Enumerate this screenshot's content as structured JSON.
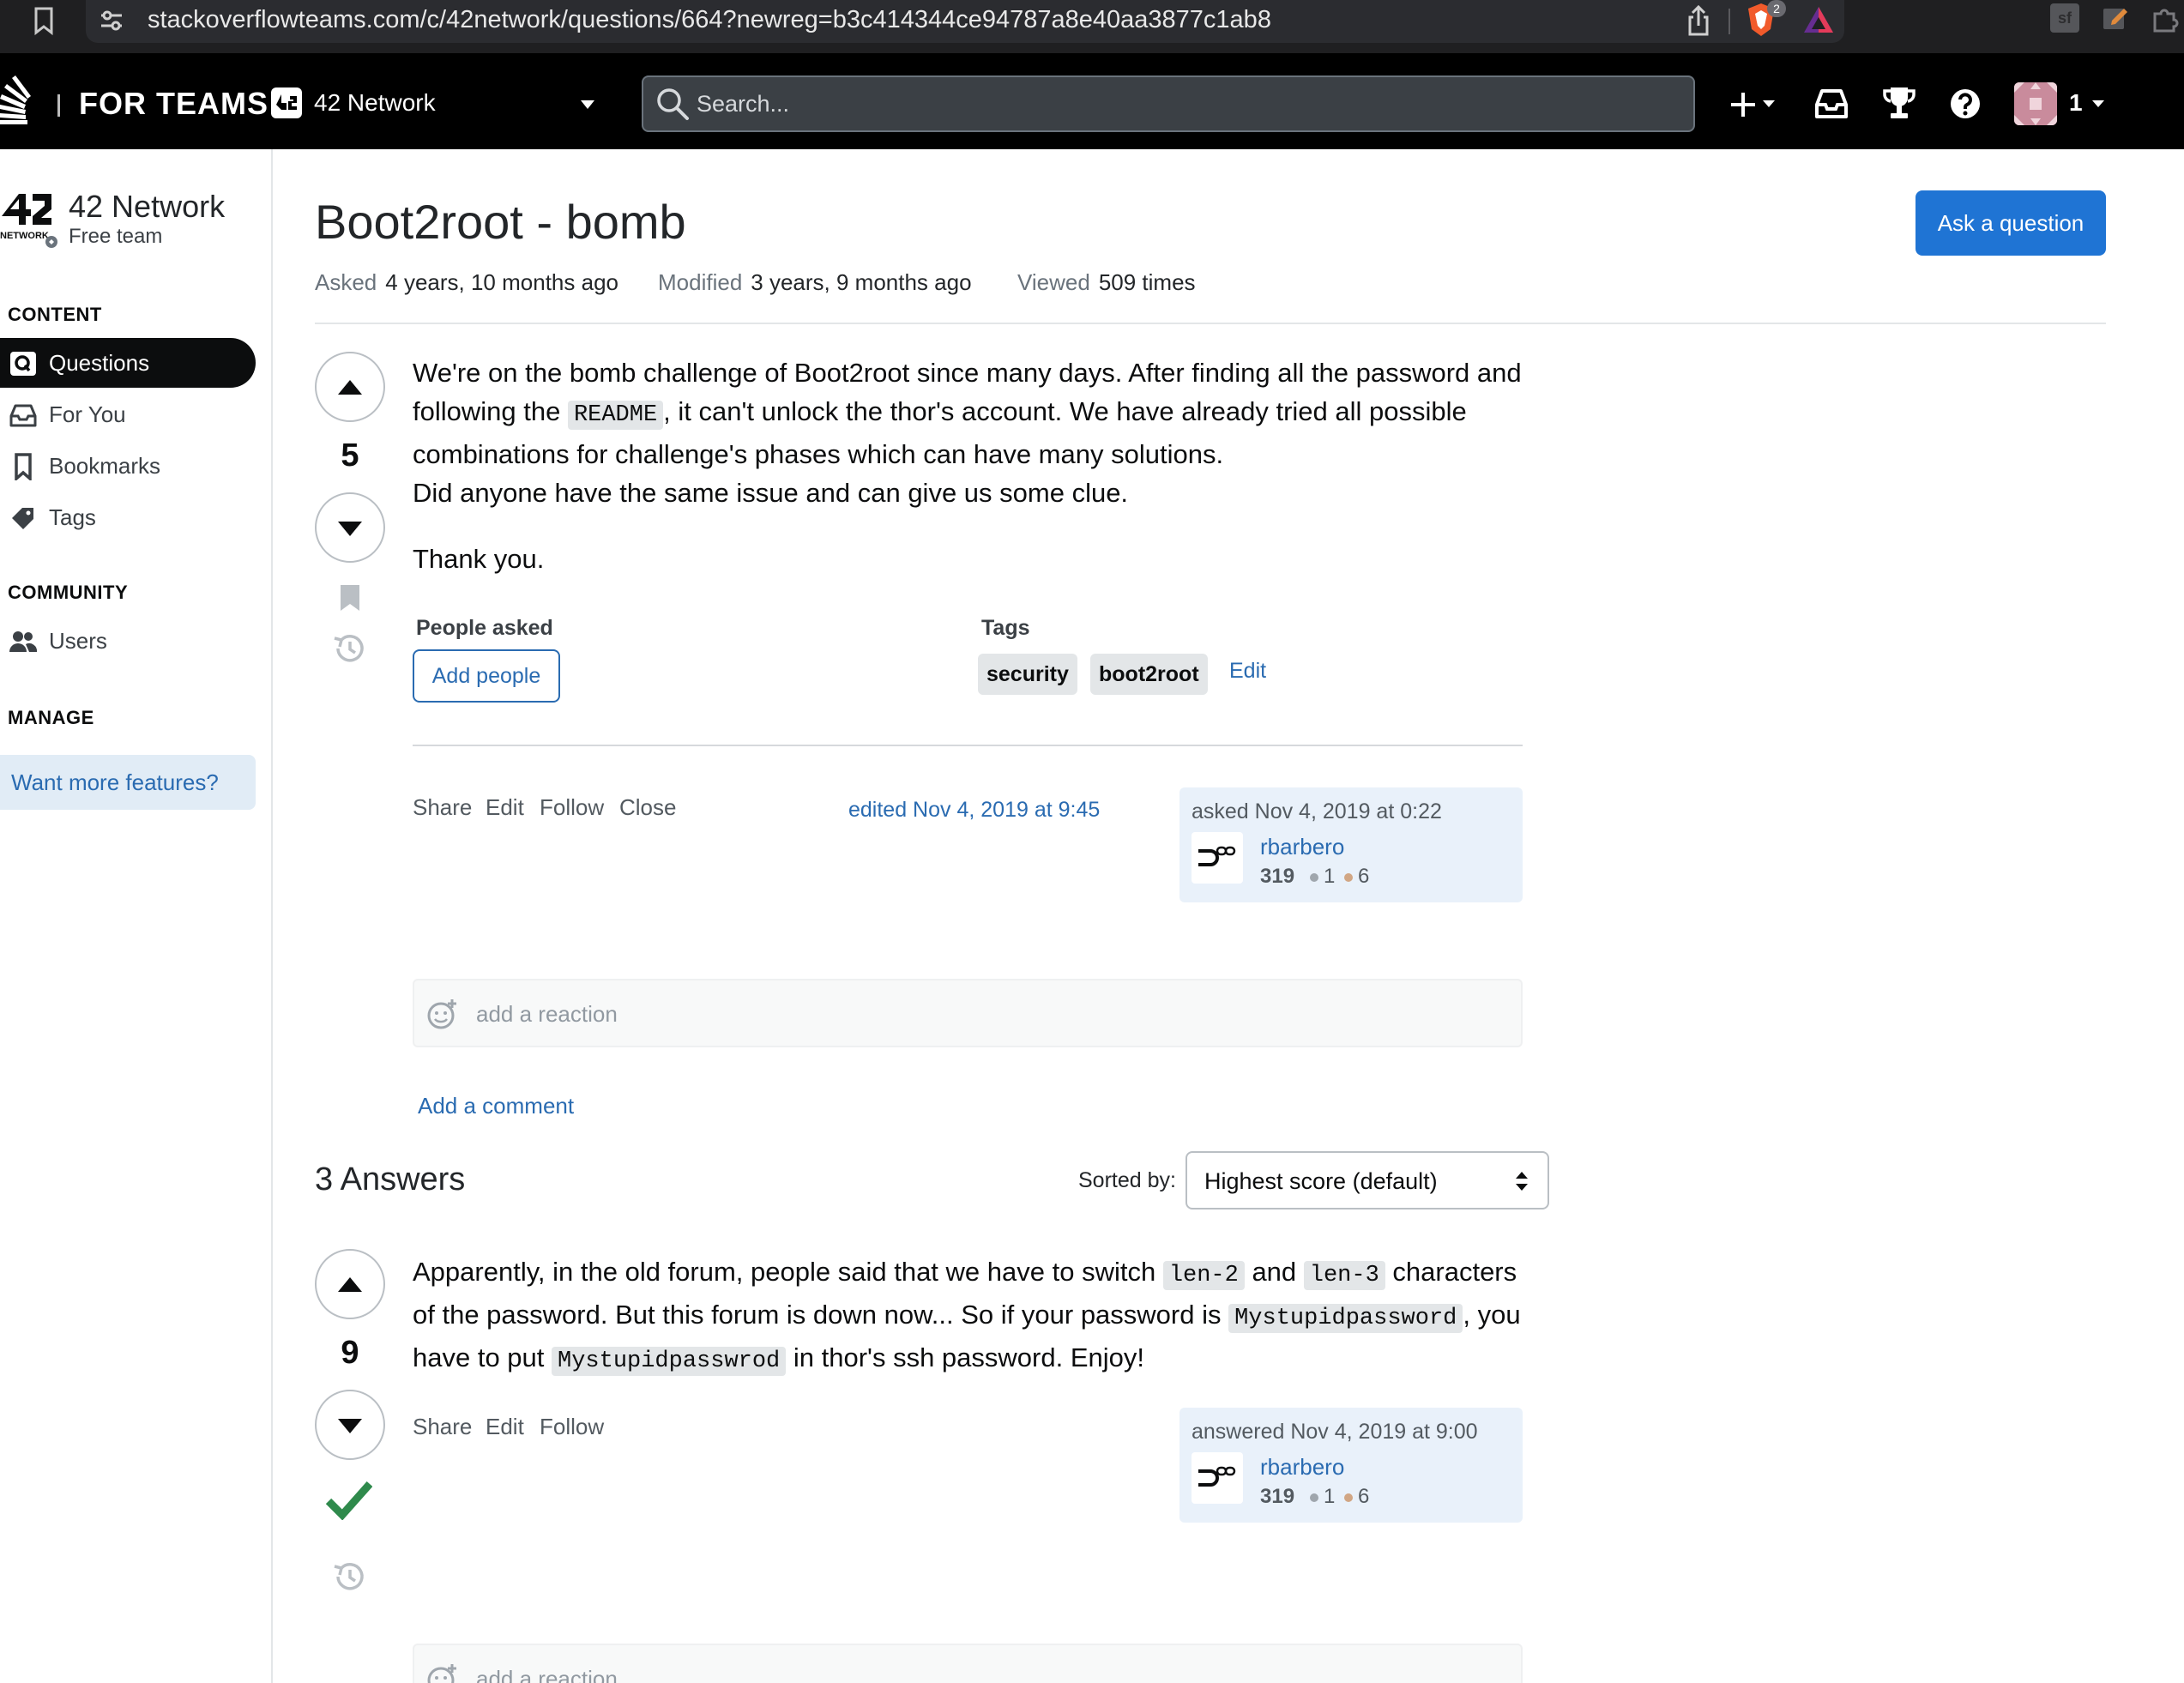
{
  "browser": {
    "url": "stackoverflowteams.com/c/42network/questions/664?newreg=b3c414344ce94787a8e40aa3877c1ab8",
    "shield_badge": "2"
  },
  "topnav": {
    "for_teams": "FOR TEAMS",
    "team_name": "42 Network",
    "search_placeholder": "Search...",
    "notification_count": "1"
  },
  "sidebar": {
    "team_name": "42 Network",
    "team_plan": "Free team",
    "sections": {
      "content": "CONTENT",
      "community": "COMMUNITY",
      "manage": "MANAGE"
    },
    "items": [
      {
        "label": "Questions",
        "icon": "questions-icon",
        "active": true
      },
      {
        "label": "For You",
        "icon": "inbox-icon",
        "active": false
      },
      {
        "label": "Bookmarks",
        "icon": "bookmark-icon",
        "active": false
      },
      {
        "label": "Tags",
        "icon": "tag-icon",
        "active": false
      },
      {
        "label": "Users",
        "icon": "users-icon",
        "active": false
      }
    ],
    "cta": "Want more features?"
  },
  "question": {
    "title": "Boot2root - bomb",
    "ask_button": "Ask a question",
    "asked_label": "Asked",
    "asked_value": "4 years, 10 months ago",
    "modified_label": "Modified",
    "modified_value": "3 years, 9 months ago",
    "viewed_label": "Viewed",
    "viewed_value": "509 times",
    "score": "5",
    "body": {
      "p1_a": "We're on the bomb challenge of Boot2root since many days. After finding all the password and following the ",
      "p1_code": "README",
      "p1_b": ", it can't unlock the thor's account. We have already tried all possible combinations for challenge's phases which can have many solutions.",
      "p1_c": "Did anyone have the same issue and can give us some clue.",
      "p2": "Thank you."
    },
    "people_asked_label": "People asked",
    "add_people": "Add people",
    "tags_label": "Tags",
    "tags": [
      "security",
      "boot2root"
    ],
    "tags_edit": "Edit",
    "menu": [
      "Share",
      "Edit",
      "Follow",
      "Close"
    ],
    "edited": "edited Nov 4, 2019 at 9:45",
    "user_card": {
      "action": "asked Nov 4, 2019 at 0:22",
      "name": "rbarbero",
      "rep": "319",
      "silver": "1",
      "bronze": "6"
    },
    "reaction": "add a reaction",
    "add_comment": "Add a comment"
  },
  "answers": {
    "count_label": "3 Answers",
    "sorted_label": "Sorted by:",
    "sort_value": "Highest score (default)",
    "items": [
      {
        "score": "9",
        "accepted": true,
        "body": {
          "t1": "Apparently, in the old forum, people said that we have to switch ",
          "c1": "len-2",
          "t2": " and ",
          "c2": "len-3",
          "t3": " characters of the password. But this forum is down now... So if your password is ",
          "c3": "Mystupidpassword",
          "t4": ", you have to put ",
          "c4": "Mystupidpasswrod",
          "t5": " in thor's ssh password. Enjoy!"
        },
        "menu": [
          "Share",
          "Edit",
          "Follow"
        ],
        "user_card": {
          "action": "answered Nov 4, 2019 at 9:00",
          "name": "rbarbero",
          "rep": "319",
          "silver": "1",
          "bronze": "6"
        },
        "reaction": "add a reaction"
      }
    ]
  },
  "colors": {
    "accent": "#1f74d4",
    "link": "#2a6bb1",
    "accepted": "#2f8a4c",
    "nav_bg": "#000000"
  }
}
